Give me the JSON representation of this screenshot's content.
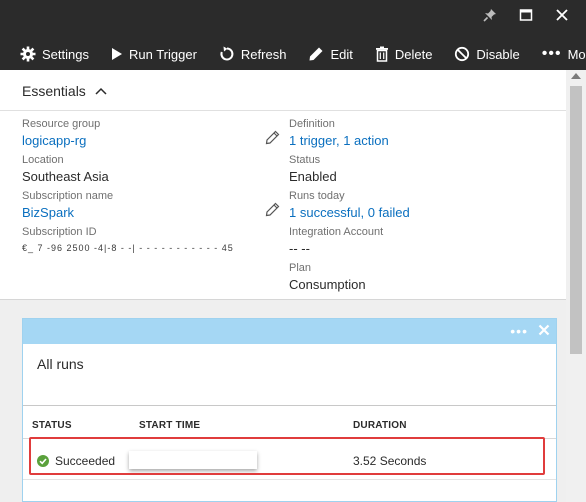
{
  "window": {
    "controls": {
      "pin_icon": "pin-icon",
      "maximize_icon": "maximize-icon",
      "close_icon": "close-icon"
    }
  },
  "toolbar": {
    "settings": "Settings",
    "run_trigger": "Run Trigger",
    "refresh": "Refresh",
    "edit": "Edit",
    "delete": "Delete",
    "disable": "Disable",
    "more": "More"
  },
  "essentials": {
    "title": "Essentials",
    "left": [
      {
        "label": "Resource group",
        "value": "logicapp-rg",
        "link": true,
        "editable": true
      },
      {
        "label": "Location",
        "value": "Southeast Asia"
      },
      {
        "label": "Subscription name",
        "value": "BizSpark",
        "link": true,
        "editable": true
      },
      {
        "label": "Subscription ID",
        "value": "€_ 7 -96 2500 -4|-8 - -|  -  - -  -  - - - - -  - -  45"
      }
    ],
    "right": [
      {
        "label": "Definition",
        "value": "1 trigger, 1 action",
        "link": true
      },
      {
        "label": "Status",
        "value": "Enabled"
      },
      {
        "label": "Runs today",
        "value": "1 successful, 0 failed",
        "link": true
      },
      {
        "label": "Integration Account",
        "value": "-- --"
      },
      {
        "label": "Plan",
        "value": "Consumption"
      }
    ]
  },
  "runs_tile": {
    "title": "All runs",
    "columns": {
      "status": "STATUS",
      "start_time": "START TIME",
      "duration": "DURATION"
    },
    "rows": [
      {
        "status": "Succeeded",
        "start_time": "",
        "duration": "3.52 Seconds"
      }
    ]
  },
  "colors": {
    "header_bg": "#2b2b2b",
    "link": "#0a6fbf",
    "tile_bar": "#a5d7f4",
    "success": "#5aa13c",
    "highlight": "#e03c3c"
  }
}
